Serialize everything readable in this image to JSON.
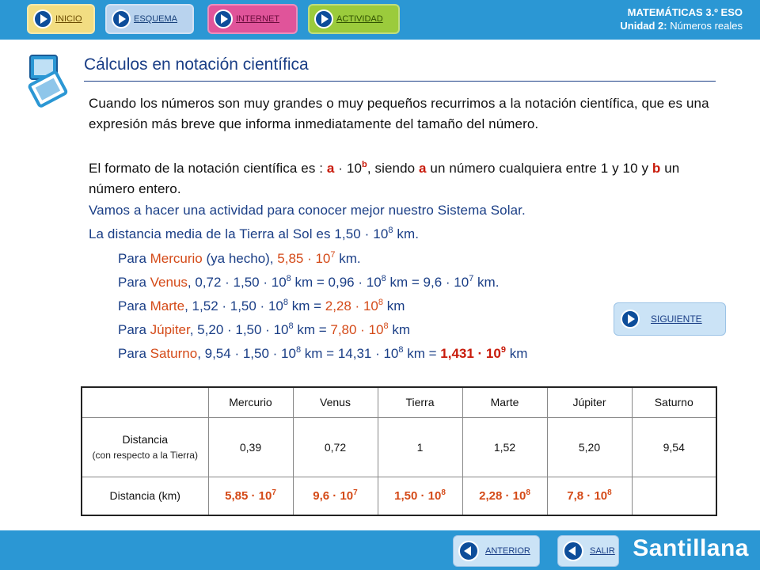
{
  "nav": {
    "inicio": "INICIO",
    "esquema": "ESQUEMA",
    "internet": "INTERNET",
    "actividad": "ACTIVIDAD"
  },
  "subject": {
    "course": "MATEMÁTICAS 3.º ESO",
    "unit_label": "Unidad 2:",
    "unit_name": "Números reales"
  },
  "title": "Cálculos en notación científica",
  "intro": "Cuando los números son muy grandes o muy pequeños recurrimos a la notación científica, que es una expresión más breve que informa inmediatamente del tamaño del número.",
  "format": {
    "t1": "El formato de la notación científica es : ",
    "a": "a",
    "dot": " · 10",
    "b_sup": "b",
    "t2": ", siendo ",
    "a2": "a",
    "t3": " un número cualquiera entre 1 y 10 y ",
    "b": "b",
    "t4": " un número entero."
  },
  "activity": "Vamos a hacer una actividad para conocer mejor nuestro Sistema Solar.",
  "earth": {
    "text": "La distancia media de la Tierra al Sol es 1,50 · 10",
    "exp": "8",
    "unit": " km."
  },
  "lines": {
    "mercurio": {
      "pre": "Para ",
      "planet": "Mercurio",
      "post": " (ya hecho), ",
      "val": "5,85 · 10",
      "exp": "7",
      "unit": " km."
    },
    "venus": {
      "pre": "Para ",
      "planet": "Venus",
      "a": ", 0,72 · 1,50 · 10",
      "e1": "8",
      "b": " km = 0,96 · 10",
      "e2": "8",
      "c": " km  = 9,6 · 10",
      "e3": "7",
      "d": " km."
    },
    "marte": {
      "pre": "Para ",
      "planet": "Marte",
      "a": ", 1,52 · 1,50 · 10",
      "e1": "8",
      "b": " km = ",
      "res": "2,28 · 10",
      "e2": "8",
      "c": " km"
    },
    "jupiter": {
      "pre": "Para ",
      "planet": "Júpiter",
      "a": ", 5,20 · 1,50 · 10",
      "e1": "8",
      "b": " km = ",
      "res": "7,80 · 10",
      "e2": "8",
      "c": " km"
    },
    "saturno": {
      "pre": "Para ",
      "planet": "Saturno",
      "a": ", 9,54 · 1,50 · 10",
      "e1": "8",
      "b": " km = 14,31 · 10",
      "e2": "8",
      "c": " km = ",
      "res": "1,431 · 10",
      "e3": "9",
      "d": " km"
    }
  },
  "next_button": "SIGUIENTE",
  "table": {
    "headers": [
      "Mercurio",
      "Venus",
      "Tierra",
      "Marte",
      "Júpiter",
      "Saturno"
    ],
    "row1_label": "Distancia",
    "row1_sublabel": "(con respecto a la Tierra)",
    "row1": [
      "0,39",
      "0,72",
      "1",
      "1,52",
      "5,20",
      "9,54"
    ],
    "row2_label": "Distancia (km)",
    "row2": [
      {
        "base": "5,85 · 10",
        "exp": "7"
      },
      {
        "base": "9,6 · 10",
        "exp": "7"
      },
      {
        "base": "1,50 · 10",
        "exp": "8"
      },
      {
        "base": "2,28 · 10",
        "exp": "8"
      },
      {
        "base": "7,8 · 10",
        "exp": "8"
      },
      {
        "base": "",
        "exp": ""
      }
    ]
  },
  "footer": {
    "anterior": "ANTERIOR",
    "salir": "SALIR",
    "brand": "Santillana"
  },
  "colors": {
    "bar": "#2b97d4",
    "title": "#1a3e86",
    "highlight": "#d44a18"
  }
}
